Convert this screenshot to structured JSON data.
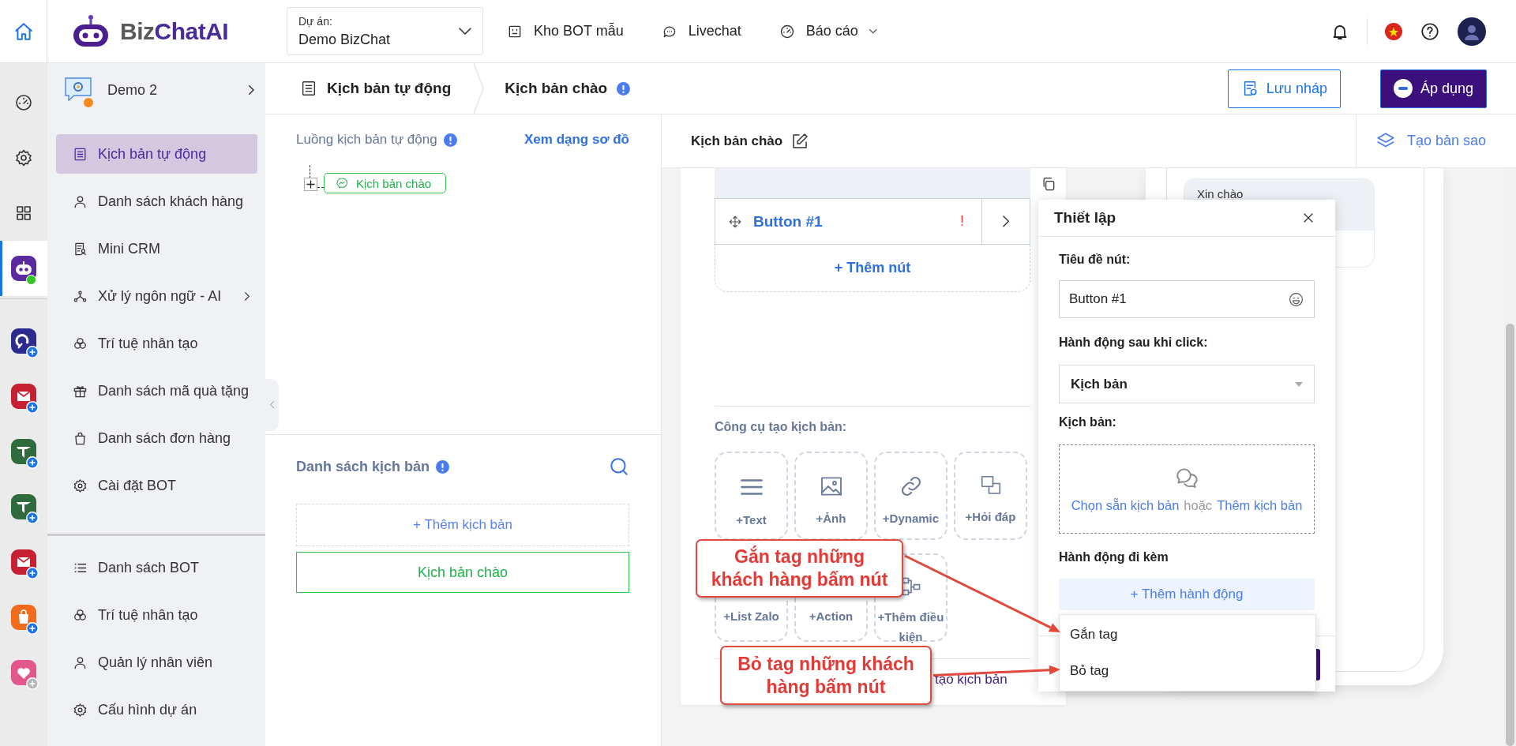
{
  "rail": {
    "nav": [
      {
        "kind": "home",
        "selected": false,
        "online": false
      },
      {
        "kind": "dashboard",
        "selected": false,
        "online": false
      },
      {
        "kind": "settings",
        "selected": false,
        "online": false
      },
      {
        "kind": "grid",
        "selected": false,
        "online": false
      },
      {
        "kind": "bot",
        "selected": true,
        "online": true
      }
    ],
    "apps": [
      {
        "kind": "swirl",
        "color": "#2b2b8f",
        "enabled": true
      },
      {
        "kind": "mail",
        "color": "#c62032",
        "enabled": true
      },
      {
        "kind": "plane",
        "color": "#2f6b3c",
        "enabled": true
      },
      {
        "kind": "plane",
        "color": "#2f6b3c",
        "enabled": true
      },
      {
        "kind": "mail",
        "color": "#c62032",
        "enabled": true
      },
      {
        "kind": "bag",
        "color": "#f26b1d",
        "enabled": true
      },
      {
        "kind": "heart",
        "color": "#e2588c",
        "enabled": false
      }
    ]
  },
  "topbar": {
    "logo": [
      "Biz",
      "ChatAI"
    ],
    "project": {
      "label": "Dự án:",
      "value": "Demo BizChat"
    },
    "nav": [
      {
        "kind": "template",
        "label": "Kho BOT mẫu",
        "dropdown": false
      },
      {
        "kind": "chat",
        "label": "Livechat",
        "dropdown": false
      },
      {
        "kind": "report",
        "label": "Báo cáo",
        "dropdown": true
      }
    ]
  },
  "toolbar": {
    "breadcrumb": [
      {
        "kind": "root",
        "label": "Kịch bản tự động",
        "info": false
      },
      {
        "kind": "page",
        "label": "Kịch bản chào",
        "info": true
      }
    ],
    "buttons": [
      {
        "kind": "outline",
        "label": "Lưu nháp"
      },
      {
        "kind": "primary",
        "label": "Áp dụng"
      }
    ]
  },
  "sidebar": {
    "project": "Demo 2",
    "items": [
      {
        "kind": "script",
        "label": "Kịch bản tự động",
        "selected": true,
        "submenu": false
      },
      {
        "kind": "person",
        "label": "Danh sách khách hàng",
        "selected": false,
        "submenu": false
      },
      {
        "kind": "crm",
        "label": "Mini CRM",
        "selected": false,
        "submenu": false
      },
      {
        "kind": "nlp",
        "label": "Xử lý ngôn ngữ - AI",
        "selected": false,
        "submenu": true
      },
      {
        "kind": "ai",
        "label": "Trí tuệ nhân tạo",
        "selected": false,
        "submenu": false
      },
      {
        "kind": "gift",
        "label": "Danh sách mã quà tặng",
        "selected": false,
        "submenu": false
      },
      {
        "kind": "bag",
        "label": "Danh sách đơn hàng",
        "selected": false,
        "submenu": false
      },
      {
        "kind": "settings",
        "label": "Cài đặt BOT",
        "selected": false,
        "submenu": false
      }
    ],
    "bottom_items": [
      {
        "kind": "list",
        "label": "Danh sách BOT",
        "selected": false,
        "submenu": false
      },
      {
        "kind": "ai",
        "label": "Trí tuệ nhân tạo",
        "selected": false,
        "submenu": false
      },
      {
        "kind": "person",
        "label": "Quản lý nhân viên",
        "selected": false,
        "submenu": false
      },
      {
        "kind": "settings",
        "label": "Cấu hình dự án",
        "selected": false,
        "submenu": false
      }
    ]
  },
  "flow": {
    "title": "Luồng kịch bản tự động",
    "link": "Xem dạng sơ đồ",
    "nodes": [
      {
        "label": "Kịch bản chào"
      }
    ]
  },
  "scripts": {
    "title": "Danh sách kịch bản",
    "add": "+ Thêm kịch bản",
    "items": [
      {
        "label": "Kịch bản chào",
        "selected": true
      }
    ]
  },
  "editor": {
    "title": "Kịch bản chào",
    "clone": "Tạo bản sao",
    "buttons": [
      {
        "label": "Button #1",
        "warning": "!"
      }
    ],
    "add_button": "+ Thêm nút",
    "tools_title": "Công cụ tạo kịch bản:",
    "tools": [
      {
        "kind": "text",
        "label": "+Text"
      },
      {
        "kind": "image",
        "label": "+Ảnh"
      },
      {
        "kind": "link",
        "label": "+Dynamic"
      },
      {
        "kind": "qa",
        "label": "+Hỏi đáp"
      },
      {
        "label": "+List Zalo"
      },
      {
        "label": "+Action"
      },
      {
        "kind": "flow",
        "label": "+Thêm điều kiện"
      }
    ],
    "footer_link": "tạo kịch bản"
  },
  "preview": {
    "messages": [
      {
        "text": "Xin chào"
      }
    ]
  },
  "settings": {
    "title": "Thiết lập",
    "title_label": "Tiêu đề nút:",
    "title_value": "Button #1",
    "action_label": "Hành động sau khi click:",
    "action_value": "Kịch bản",
    "script_label": "Kịch bản:",
    "choose": "Chọn sẵn kịch bản",
    "or": "hoặc",
    "add": "Thêm kịch bản",
    "extra_label": "Hành động đi kèm",
    "add_action": "+ Thêm hành động",
    "menu": [
      {
        "label": "Gắn tag"
      },
      {
        "label": "Bỏ tag"
      }
    ]
  },
  "callouts": [
    {
      "text": "Gắn tag những khách hàng bấm nút"
    },
    {
      "text": "Bỏ tag những khách hàng bấm nút"
    }
  ]
}
